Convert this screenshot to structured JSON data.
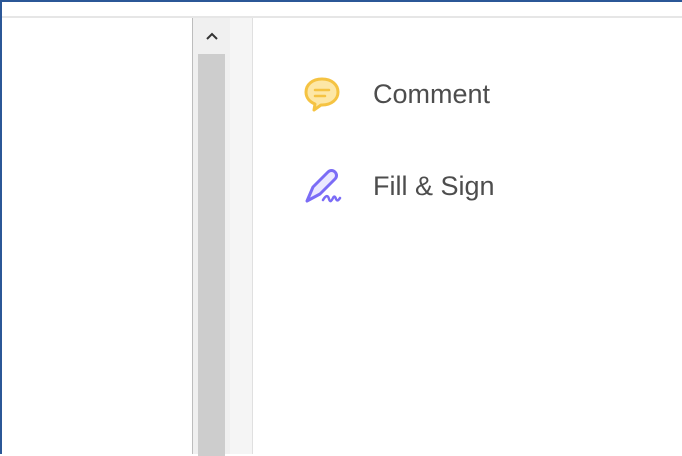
{
  "tools_panel": {
    "items": [
      {
        "label": "Comment",
        "icon": "comment-bubble-icon",
        "icon_color": "#f5c342"
      },
      {
        "label": "Fill & Sign",
        "icon": "fill-sign-pen-icon",
        "icon_color": "#7b6cf6"
      }
    ]
  },
  "scrollbar": {
    "up_arrow_icon": "chevron-up-icon"
  },
  "colors": {
    "frame_border": "#2b5797",
    "scroll_thumb": "#cdcdcd",
    "label_text": "#4d4d4d"
  }
}
